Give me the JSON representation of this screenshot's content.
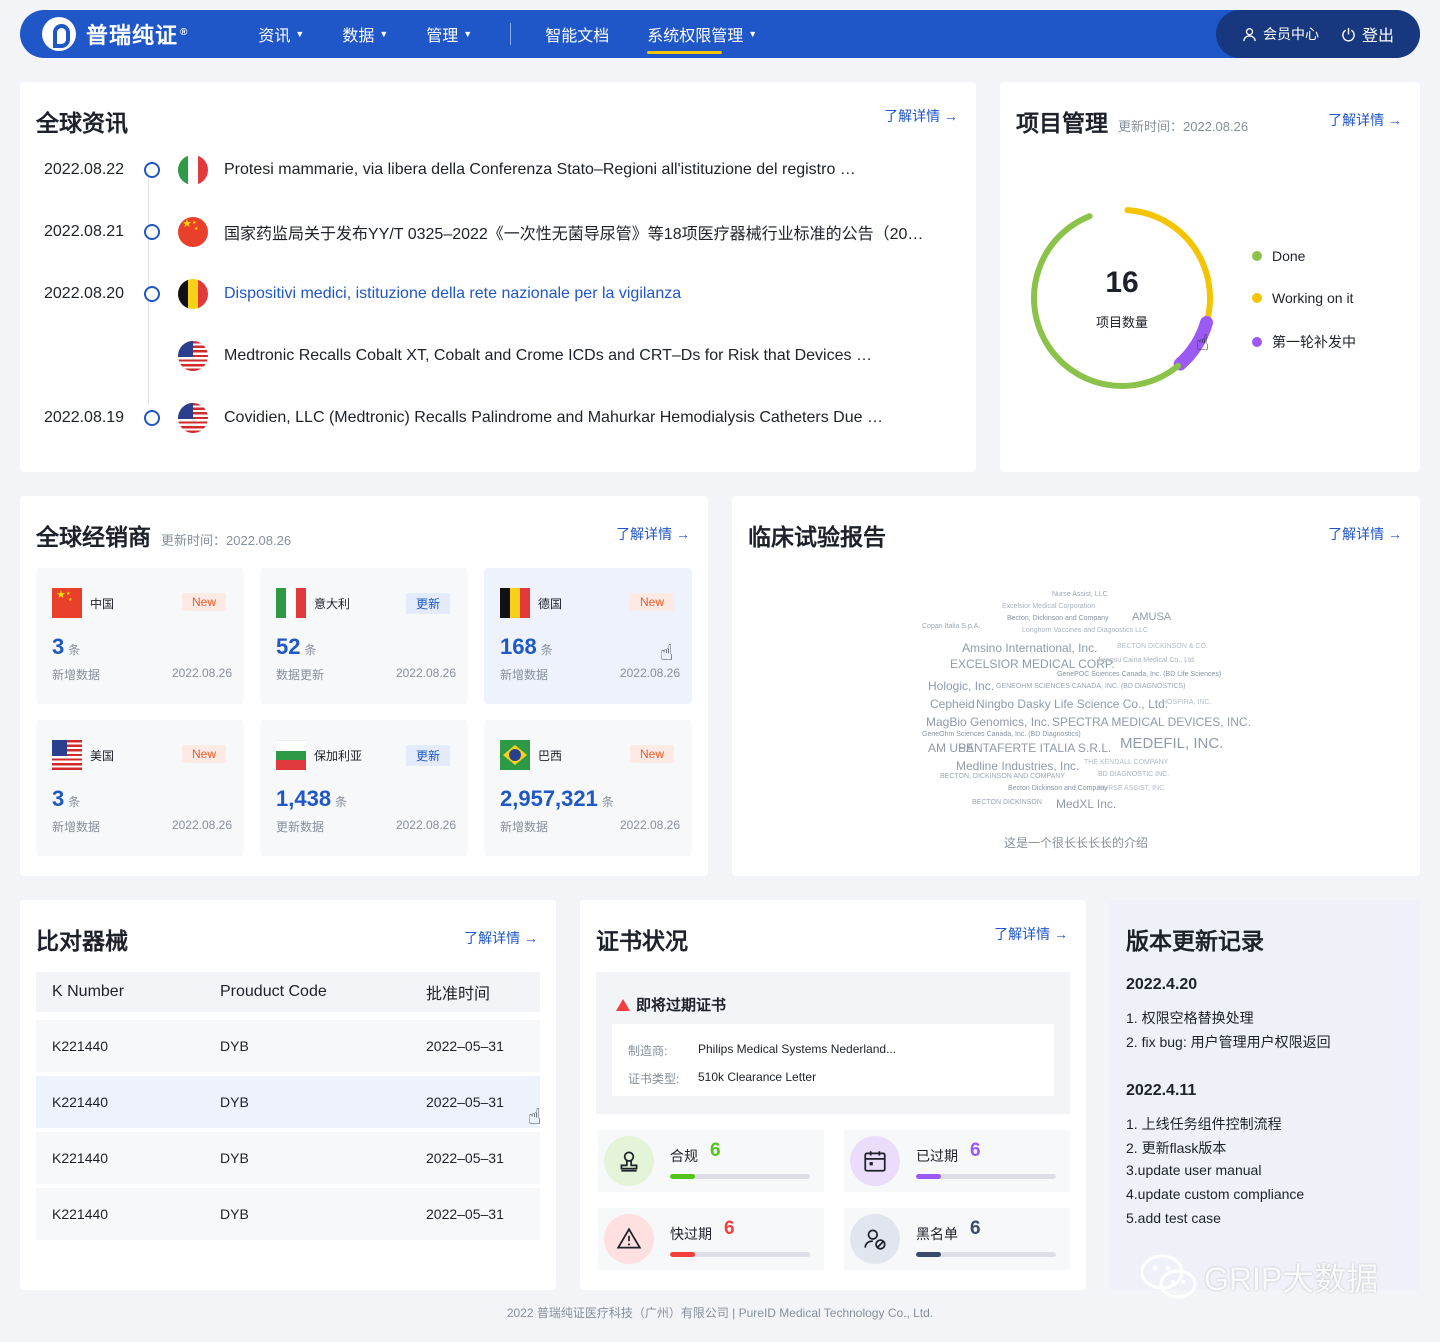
{
  "nav": {
    "logo_text": "普瑞纯证",
    "logo_reg": "®",
    "menu": [
      {
        "label": "资讯",
        "has_dropdown": true
      },
      {
        "label": "数据",
        "has_dropdown": true
      },
      {
        "label": "管理",
        "has_dropdown": true
      },
      {
        "label": "智能文档",
        "has_dropdown": false
      },
      {
        "label": "系统权限管理",
        "has_dropdown": true,
        "active": true
      }
    ],
    "member_center": "会员中心",
    "logout": "登出"
  },
  "news": {
    "title": "全球资讯",
    "more": "了解详情",
    "items": [
      {
        "date": "2022.08.22",
        "country": "Italy",
        "text": "Protesi mammarie, via libera della Conferenza Stato–Regioni all'istituzione del registro …"
      },
      {
        "date": "2022.08.21",
        "country": "China",
        "text": "国家药监局关于发布YY/T 0325–2022《一次性无菌导尿管》等18项医疗器械行业标准的公告（20…"
      },
      {
        "date": "2022.08.20",
        "country": "Belgium",
        "text": "Dispositivi medici, istituzione della rete nazionale per la vigilanza",
        "link": true
      },
      {
        "date": "",
        "country": "USA",
        "text": "Medtronic Recalls Cobalt XT, Cobalt and Crome ICDs and CRT–Ds for Risk that Devices …"
      },
      {
        "date": "2022.08.19",
        "country": "USA",
        "text": "Covidien, LLC (Medtronic) Recalls Palindrome and Mahurkar Hemodialysis Catheters Due …"
      }
    ]
  },
  "project": {
    "title": "项目管理",
    "updated": "更新时间：2022.08.26",
    "more": "了解详情",
    "total": "16",
    "total_label": "项目数量",
    "segments": [
      {
        "name": "Done",
        "value": 0.55,
        "color": "#8bc34a"
      },
      {
        "name": "Working on it",
        "value": 0.28,
        "color": "#f5c400"
      },
      {
        "name": "第一轮补发中",
        "value": 0.09,
        "color": "#9b59f5"
      }
    ]
  },
  "distributors": {
    "title": "全球经销商",
    "updated": "更新时间：2022.08.26",
    "more": "了解详情",
    "unit": "条",
    "tiles": [
      {
        "country": "中国",
        "flag": "China",
        "badge": "New",
        "badge_type": "new",
        "count": "3",
        "label": "新增数据",
        "date": "2022.08.26"
      },
      {
        "country": "意大利",
        "flag": "Italy",
        "badge": "更新",
        "badge_type": "upd",
        "count": "52",
        "label": "数据更新",
        "date": "2022.08.26"
      },
      {
        "country": "德国",
        "flag": "Belgium",
        "badge": "New",
        "badge_type": "new",
        "count": "168",
        "label": "新增数据",
        "date": "2022.08.26",
        "hover": true
      },
      {
        "country": "美国",
        "flag": "USA",
        "badge": "New",
        "badge_type": "new",
        "count": "3",
        "label": "新增数据",
        "date": "2022.08.26"
      },
      {
        "country": "保加利亚",
        "flag": "Bulgaria",
        "badge": "更新",
        "badge_type": "upd",
        "count": "1,438",
        "label": "更新数据",
        "date": "2022.08.26"
      },
      {
        "country": "巴西",
        "flag": "Brazil",
        "badge": "New",
        "badge_type": "new",
        "count": "2,957,321",
        "label": "新增数据",
        "date": "2022.08.26"
      }
    ]
  },
  "clinical": {
    "title": "临床试验报告",
    "more": "了解详情",
    "caption": "这是一个很长长长长的介绍",
    "words": [
      "Nurse Assist, LLC",
      "Excelsior Medical Corporation",
      "Becton, Dickinson and Company",
      "AMUSA",
      "Copan Italia S.p.A.",
      "Longhorn Vaccines and Diagnostics LLC",
      "Amsino International, Inc.",
      "BECTON DICKINSON & CO.",
      "EXCELSIOR MEDICAL CORP.",
      "Jiangsu Caina Medical Co., Ltd.",
      "GenePOC Sciences Canada, Inc. (BD Life Sciences)",
      "Hologic, Inc.",
      "GENEOHM SCIENCES CANADA, INC. (BD DIAGNOSTICS)",
      "Cepheid",
      "Ningbo Dasky Life Science Co., Ltd.",
      "HOSPIRA, INC.",
      "MagBio Genomics, Inc.",
      "SPECTRA MEDICAL DEVICES, INC.",
      "GeneOhm Sciences Canada, Inc. (BD Diagnostics)",
      "AM USA",
      "PENTAFERTE ITALIA S.R.L.",
      "MEDEFIL, INC.",
      "Medline Industries, Inc.",
      "THE KENDALL COMPANY",
      "BECTON, DICKINSON AND COMPANY",
      "BD DIAGNOSTIC INC.",
      "Becton Dickinson and Company",
      "NURSE ASSIST, INC.",
      "BECTON DICKINSON",
      "MedXL Inc."
    ]
  },
  "compare": {
    "title": "比对器械",
    "more": "了解详情",
    "columns": [
      "K Number",
      "Prouduct Code",
      "批准时间"
    ],
    "rows": [
      [
        "K221440",
        "DYB",
        "2022–05–31"
      ],
      [
        "K221440",
        "DYB",
        "2022–05–31"
      ],
      [
        "K221440",
        "DYB",
        "2022–05–31"
      ],
      [
        "K221440",
        "DYB",
        "2022–05–31"
      ]
    ]
  },
  "certs": {
    "title": "证书状况",
    "more": "了解详情",
    "expiring_title": "即将过期证书",
    "manufacturer_key": "制造商:",
    "manufacturer_val": "Philips Medical Systems Nederland...",
    "type_key": "证书类型:",
    "type_val": "510k Clearance Letter",
    "stats": [
      {
        "label": "合规",
        "value": "6",
        "fraction": 0.18,
        "color": "#52c41a",
        "bg": "#e3f4d9",
        "num_color": "#52c41a",
        "icon": "stamp-icon"
      },
      {
        "label": "已过期",
        "value": "6",
        "fraction": 0.18,
        "color": "#9b59f5",
        "bg": "#eadcfb",
        "num_color": "#9b59f5",
        "icon": "calendar-icon"
      },
      {
        "label": "快过期",
        "value": "6",
        "fraction": 0.18,
        "color": "#f53f3f",
        "bg": "#fde0df",
        "num_color": "#f53f3f",
        "icon": "warning-icon"
      },
      {
        "label": "黑名单",
        "value": "6",
        "fraction": 0.18,
        "color": "#3a4a6b",
        "bg": "#e1e5ee",
        "num_color": "#3a4a6b",
        "icon": "user-block-icon"
      }
    ]
  },
  "changelog": {
    "title": "版本更新记录",
    "versions": [
      {
        "version": "2022.4.20",
        "items": [
          "1. 权限空格替换处理",
          "2. fix bug: 用户管理用户权限返回"
        ]
      },
      {
        "version": "2022.4.11",
        "items": [
          "1. 上线任务组件控制流程",
          "2. 更新flask版本",
          "3.update user manual",
          "4.update custom compliance",
          "5.add test case"
        ]
      }
    ]
  },
  "footer": "2022 普瑞纯证医疗科技（广州）有限公司 | PureID Medical Technology Co., Ltd.",
  "watermark": "GRIP大数据"
}
